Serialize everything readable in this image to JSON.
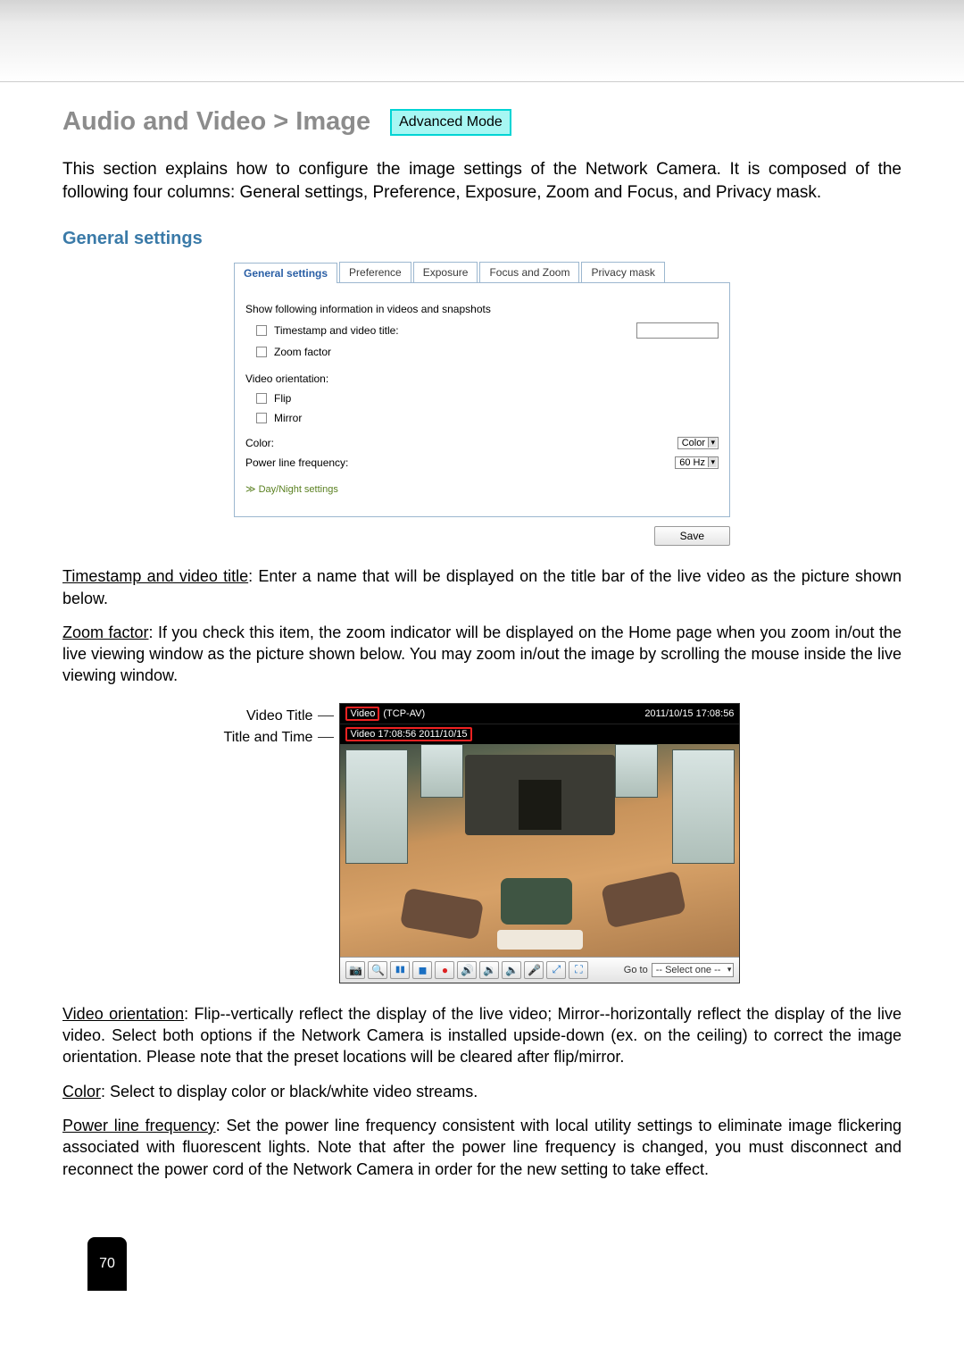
{
  "header": {
    "title": "Audio and Video > Image",
    "mode_badge": "Advanced Mode"
  },
  "intro": "This section explains how to configure the image settings of the Network Camera. It is composed of the following four columns: General settings, Preference, Exposure, Zoom and Focus, and Privacy mask.",
  "section_heading": "General settings",
  "tabs": {
    "general": "General settings",
    "preference": "Preference",
    "exposure": "Exposure",
    "focus_zoom": "Focus and Zoom",
    "privacy": "Privacy mask"
  },
  "panel": {
    "show_info_heading": "Show following information in videos and snapshots",
    "timestamp_label": "Timestamp and video title:",
    "zoom_factor": "Zoom factor",
    "video_orientation_heading": "Video orientation:",
    "flip": "Flip",
    "mirror": "Mirror",
    "color_label": "Color:",
    "color_value": "Color",
    "powerline_label": "Power line frequency:",
    "powerline_value": "60 Hz",
    "disclose": "Day/Night settings",
    "save": "Save"
  },
  "body": {
    "timestamp_term": "Timestamp and video title",
    "timestamp_text": ": Enter a name that will be displayed on the title bar of the live video as the picture shown below.",
    "zoom_term": "Zoom factor",
    "zoom_text": ": If you check this item, the zoom indicator will be displayed on the Home page when you zoom in/out the live viewing window as the picture shown below. You may zoom in/out the image by scrolling the mouse inside the live viewing window.",
    "orientation_term": "Video orientation",
    "orientation_text": ": Flip--vertically reflect the display of the live video; Mirror--horizontally reflect the display of the live video. Select both options if the Network Camera is installed upside-down (ex. on the ceiling) to correct the image orientation. Please note that the preset locations will be cleared after flip/mirror.",
    "color_term": "Color",
    "color_text": ": Select to display color or black/white video streams.",
    "powerline_term": "Power line frequency",
    "powerline_text": ": Set the power line frequency consistent with local utility settings to eliminate image flickering associated with fluorescent lights. Note that after the power line frequency is changed, you must disconnect and reconnect the power cord of the Network Camera in order for the new setting to take effect."
  },
  "figure": {
    "callout_video_title": "Video Title",
    "callout_title_time": "Title and Time",
    "titlebar_video": "Video",
    "titlebar_protocol": "(TCP-AV)",
    "titlebar_timestamp": "2011/10/15  17:08:56",
    "osd_text": "Video 17:08:56 2011/10/15",
    "goto_label": "Go to",
    "goto_value": "-- Select one --"
  },
  "page_number": "70",
  "icons": {
    "snapshot": "📷",
    "zoom": "🔍",
    "pause": "▮▮",
    "stop": "◼",
    "record": "●",
    "vol_up": "🔊",
    "vol_down": "🔉",
    "speaker": "🔈",
    "mic": "🎤",
    "fullscreen": "⛶",
    "extra1": "⤢",
    "extra2": "◧"
  }
}
